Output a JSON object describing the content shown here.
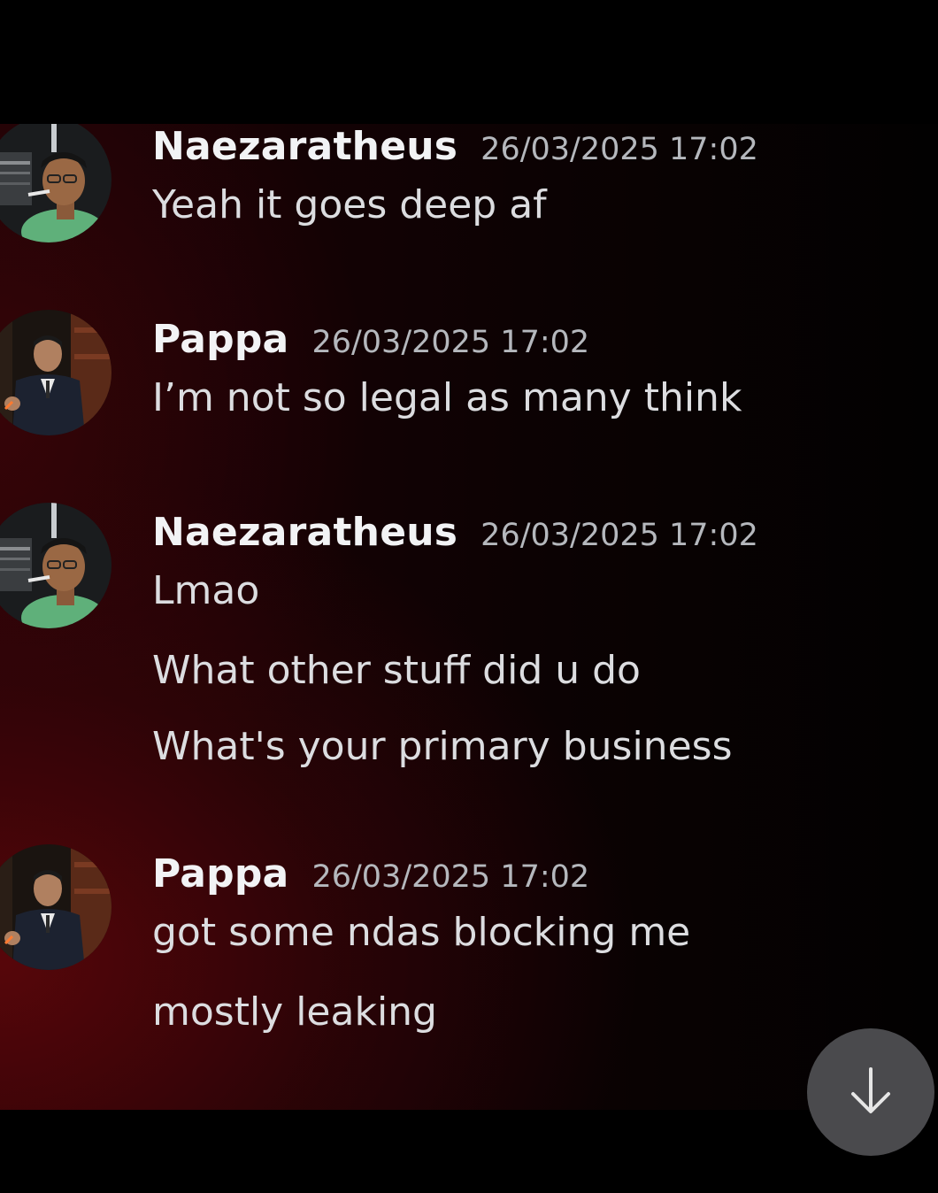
{
  "messages": [
    {
      "username": "Naezaratheus",
      "timestamp": "26/03/2025 17:02",
      "avatar": "naezaratheus-avatar",
      "lines": [
        "Yeah it goes deep af"
      ]
    },
    {
      "username": "Pappa",
      "timestamp": "26/03/2025 17:02",
      "avatar": "pappa-avatar",
      "lines": [
        "I’m not so legal as many think"
      ]
    },
    {
      "username": "Naezaratheus",
      "timestamp": "26/03/2025 17:02",
      "avatar": "naezaratheus-avatar",
      "lines": [
        "Lmao",
        "What other stuff did u do",
        "What's your primary business"
      ]
    },
    {
      "username": "Pappa",
      "timestamp": "26/03/2025 17:02",
      "avatar": "pappa-avatar",
      "lines": [
        "got some ndas blocking me",
        "mostly leaking"
      ]
    }
  ],
  "scroll_button": {
    "icon": "arrow-down-icon"
  },
  "colors": {
    "username": "#f2f3f5",
    "timestamp": "#b5b8bd",
    "message": "#dcdde0",
    "scroll_button_bg": "#4a4a4d"
  }
}
